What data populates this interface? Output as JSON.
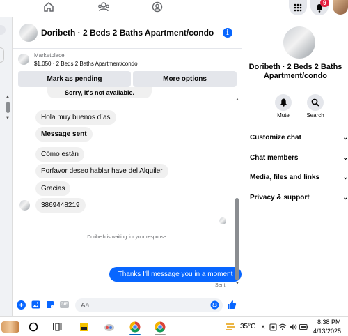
{
  "conversation": {
    "title": "Doribeth · 2 Beds 2 Baths Apartment/condo",
    "marketplace_label": "Marketplace",
    "listing_summary": "$1,050 · 2 Beds 2 Baths Apartment/condo",
    "mark_pending_label": "Mark as pending",
    "more_options_label": "More options"
  },
  "messages": {
    "partial_top": "Sorry, it's not available.",
    "items": [
      {
        "text": "Hola muy buenos días"
      },
      {
        "text": "Message sent"
      },
      {
        "text": "Cómo están"
      },
      {
        "text": "Porfavor deseo hablar have del Alquiler"
      },
      {
        "text": "Gracias"
      },
      {
        "text": "3869448219"
      }
    ],
    "waiting_notice": "Doribeth is waiting for your response.",
    "outgoing": "Thanks I'll message you in a moment",
    "sent_status": "Sent"
  },
  "composer": {
    "placeholder": "Aa"
  },
  "right_panel": {
    "title": "Doribeth · 2 Beds 2 Baths Apartment/condo",
    "mute_label": "Mute",
    "search_label": "Search",
    "sections": [
      "Customize chat",
      "Chat members",
      "Media, files and links",
      "Privacy & support"
    ]
  },
  "top_nav": {
    "notification_count": "9"
  },
  "taskbar": {
    "temperature": "35°C",
    "time": "8:38 PM",
    "date": "4/13/2025"
  },
  "colors": {
    "accent": "#0866ff",
    "bubble_incoming": "#f0f0f0",
    "badge": "#e41e3f"
  }
}
